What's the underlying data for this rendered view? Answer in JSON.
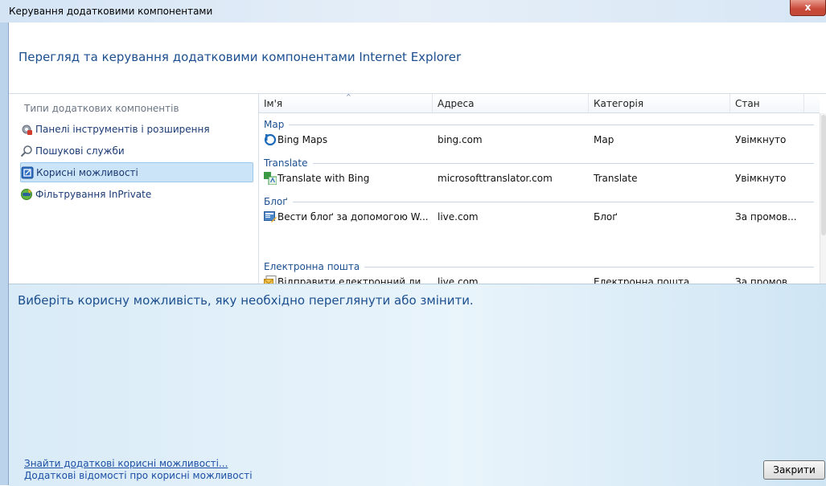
{
  "window": {
    "title": "Керування додатковими компонентами",
    "close_glyph": "x"
  },
  "header": {
    "title": "Перегляд та керування додатковими компонентами Internet Explorer"
  },
  "left_pane": {
    "heading": "Типи додаткових компонентів",
    "items": [
      {
        "label": "Панелі інструментів і розширення",
        "icon": "gear-icon",
        "selected": false
      },
      {
        "label": "Пошукові служби",
        "icon": "search-icon",
        "selected": false
      },
      {
        "label": "Корисні можливості",
        "icon": "accelerator-icon",
        "selected": true
      },
      {
        "label": "Фільтрування InPrivate",
        "icon": "inprivate-icon",
        "selected": false
      }
    ]
  },
  "list": {
    "columns": [
      "Ім'я",
      "Адреса",
      "Категорія",
      "Стан"
    ],
    "sort_glyph": "^",
    "groups": [
      {
        "name": "Map",
        "rows": [
          {
            "name": "Bing Maps",
            "address": "bing.com",
            "category": "Map",
            "status": "Увімкнуто",
            "icon": "bing-icon"
          }
        ]
      },
      {
        "name": "Translate",
        "rows": [
          {
            "name": "Translate with Bing",
            "address": "microsofttranslator.com",
            "category": "Translate",
            "status": "Увімкнуто",
            "icon": "translate-icon"
          }
        ]
      },
      {
        "name": "Блоґ",
        "rows": [
          {
            "name": "Вести блоґ за допомогою W...",
            "address": "live.com",
            "category": "Блоґ",
            "status": "За промов...",
            "icon": "blog-icon"
          }
        ]
      },
      {
        "name": "Електронна пошта",
        "rows": [
          {
            "name": "Відправити електронний ли...",
            "address": "live.com",
            "category": "Електронна пошта",
            "status": "За промов...",
            "icon": "email-icon"
          }
        ]
      }
    ]
  },
  "details": {
    "prompt": "Виберіть корисну можливість, яку необхідно переглянути або змінити."
  },
  "footer": {
    "link_find": "Знайти додаткові корисні можливості...",
    "link_info": "Додаткові відомості про корисні можливості",
    "close_label": "Закрити"
  }
}
